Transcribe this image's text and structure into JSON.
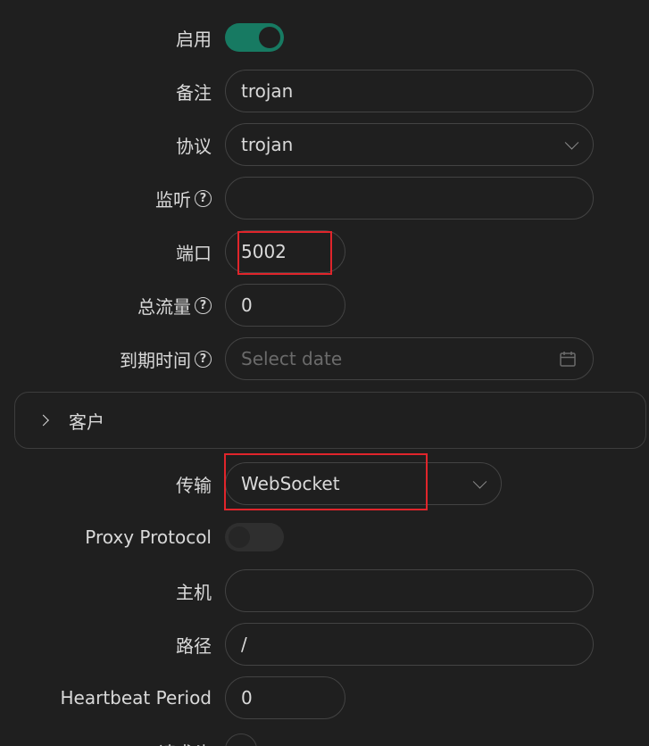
{
  "form": {
    "enable": {
      "label": "启用",
      "checked": true
    },
    "remark": {
      "label": "备注",
      "value": "trojan"
    },
    "protocol": {
      "label": "协议",
      "value": "trojan"
    },
    "listen": {
      "label": "监听",
      "value": "",
      "help_icon": "question-circle-icon"
    },
    "port": {
      "label": "端口",
      "value": "5002"
    },
    "total_traffic": {
      "label": "总流量",
      "value": "0",
      "help_icon": "question-circle-icon"
    },
    "expiry": {
      "label": "到期时间",
      "placeholder": "Select date",
      "help_icon": "question-circle-icon"
    }
  },
  "clients_panel": {
    "title": "客户",
    "expanded": false
  },
  "stream": {
    "transport": {
      "label": "传输",
      "value": "WebSocket"
    },
    "proxy_protocol": {
      "label": "Proxy Protocol",
      "checked": false
    },
    "host": {
      "label": "主机",
      "value": ""
    },
    "path": {
      "label": "路径",
      "value": "/"
    },
    "heartbeat": {
      "label": "Heartbeat Period",
      "value": "0"
    },
    "request_header": {
      "label": "请求头"
    }
  },
  "colors": {
    "background": "#1f1f1f",
    "accent": "#177a62",
    "highlight_box": "#e0252b",
    "text": "#d9d9d9",
    "placeholder": "#6b6b6b"
  }
}
